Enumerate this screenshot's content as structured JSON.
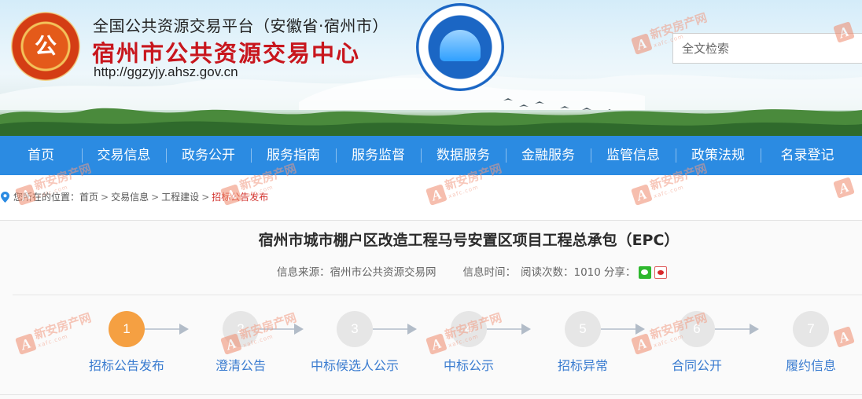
{
  "header": {
    "title_line1": "全国公共资源交易平台（安徽省·宿州市）",
    "title_line2": "宿州市公共资源交易中心",
    "url": "http://ggzyjy.ahsz.gov.cn",
    "logo_glyph": "公",
    "search_placeholder": "全文检索"
  },
  "nav": {
    "items": [
      {
        "label": "首页"
      },
      {
        "label": "交易信息"
      },
      {
        "label": "政务公开"
      },
      {
        "label": "服务指南"
      },
      {
        "label": "服务监督"
      },
      {
        "label": "数据服务"
      },
      {
        "label": "金融服务"
      },
      {
        "label": "监管信息"
      },
      {
        "label": "政策法规"
      },
      {
        "label": "名录登记"
      }
    ]
  },
  "breadcrumb": {
    "prefix": "您所在的位置：",
    "items": [
      "首页",
      "交易信息",
      "工程建设",
      "招标公告发布"
    ],
    "separator": ">"
  },
  "article": {
    "title": "宿州市城市棚户区改造工程马号安置区项目工程总承包（EPC）",
    "source_label": "信息来源：",
    "source_value": "宿州市公共资源交易网",
    "time_label": "信息时间：",
    "views_label": "阅读次数：",
    "views_value": "1010",
    "share_label": "分享："
  },
  "steps": [
    {
      "number": "1",
      "label": "招标公告发布",
      "active": true
    },
    {
      "number": "2",
      "label": "澄清公告",
      "active": false
    },
    {
      "number": "3",
      "label": "中标候选人公示",
      "active": false
    },
    {
      "number": "4",
      "label": "中标公示",
      "active": false
    },
    {
      "number": "5",
      "label": "招标异常",
      "active": false
    },
    {
      "number": "6",
      "label": "合同公开",
      "active": false
    },
    {
      "number": "7",
      "label": "履约信息",
      "active": false
    }
  ],
  "watermark": {
    "glyph": "A",
    "text": "新安房产网",
    "sub": "xafc.com"
  },
  "colors": {
    "nav_bg": "#2b8be2",
    "title_red": "#c8161d",
    "step_active": "#f5a042",
    "step_inactive": "#e6e6e6",
    "step_label": "#3a7cd0",
    "breadcrumb_active": "#d2322d"
  }
}
